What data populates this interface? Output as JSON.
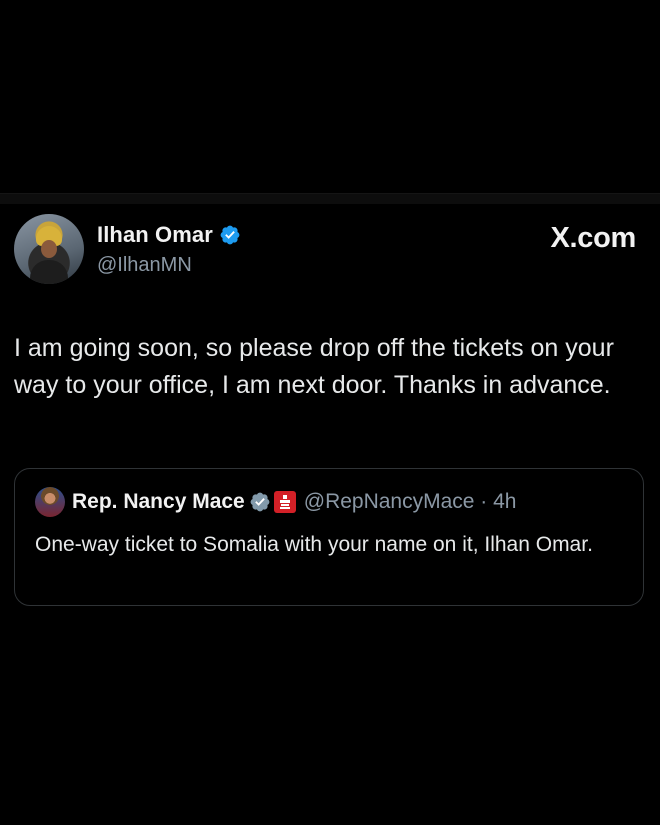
{
  "tweet": {
    "author": {
      "display_name": "Ilhan Omar",
      "handle": "@IlhanMN",
      "verified_icon": "verified-badge-icon",
      "verified_color": "#1d9bf0"
    },
    "brand": "X.com",
    "text": "I am going soon, so please drop off the tickets on your way to your office, I am next door. Thanks in advance."
  },
  "quote": {
    "author": {
      "display_name": "Rep. Nancy Mace",
      "handle_and_time": "@RepNancyMace · 4h",
      "verified_icon": "verified-badge-gray-icon",
      "government_icon": "capitol-icon",
      "government_color": "#d32027"
    },
    "text": "One-way ticket to Somalia with your name on it, Ilhan Omar."
  },
  "colors": {
    "background": "#000000",
    "text_primary": "#e7e9ea",
    "text_secondary": "#8b98a5",
    "border": "#2f3336"
  }
}
